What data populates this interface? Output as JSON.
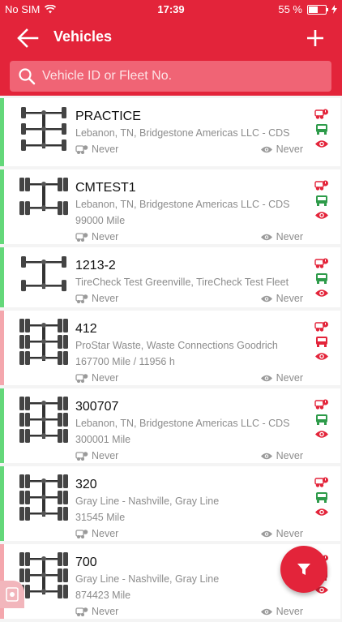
{
  "status_bar": {
    "carrier": "No SIM",
    "time": "17:39",
    "battery": "55 %",
    "battery_level": 0.55
  },
  "header": {
    "title": "Vehicles"
  },
  "search": {
    "placeholder": "Vehicle ID or Fleet No."
  },
  "colors": {
    "accent": "#e3243a",
    "ok": "#64d87a",
    "warn": "#f4a7ad",
    "status_green": "#2e9b4a",
    "status_red": "#e3243a"
  },
  "vehicles": [
    {
      "id": "PRACTICE",
      "location": "Lebanon, TN, Bridgestone Americas LLC - CDS",
      "mileage": "",
      "last_inspection": "Never",
      "last_viewed": "Never",
      "status": "ok"
    },
    {
      "id": "CMTEST1",
      "location": "Lebanon, TN, Bridgestone Americas LLC - CDS",
      "mileage": "99000 Mile",
      "last_inspection": "Never",
      "last_viewed": "Never",
      "status": "ok"
    },
    {
      "id": "1213-2",
      "location": "TireCheck Test Greenville, TireCheck Test Fleet",
      "mileage": "",
      "last_inspection": "Never",
      "last_viewed": "Never",
      "status": "ok"
    },
    {
      "id": "412",
      "location": "ProStar Waste, Waste Connections Goodrich",
      "mileage": "167700 Mile / 11956 h",
      "last_inspection": "Never",
      "last_viewed": "Never",
      "status": "warn"
    },
    {
      "id": "300707",
      "location": "Lebanon, TN, Bridgestone Americas LLC - CDS",
      "mileage": "300001 Mile",
      "last_inspection": "Never",
      "last_viewed": "Never",
      "status": "ok"
    },
    {
      "id": "320",
      "location": "Gray Line - Nashville, Gray Line",
      "mileage": "31545 Mile",
      "last_inspection": "Never",
      "last_viewed": "Never",
      "status": "ok"
    },
    {
      "id": "700",
      "location": "Gray Line - Nashville, Gray Line",
      "mileage": "874423 Mile",
      "last_inspection": "Never",
      "last_viewed": "Never",
      "status": "warn"
    }
  ],
  "icons": {
    "back": "arrow-left-icon",
    "add": "plus-icon",
    "search": "search-icon",
    "inspection": "tire-check-icon",
    "viewed": "eye-icon",
    "filter": "filter-icon"
  }
}
